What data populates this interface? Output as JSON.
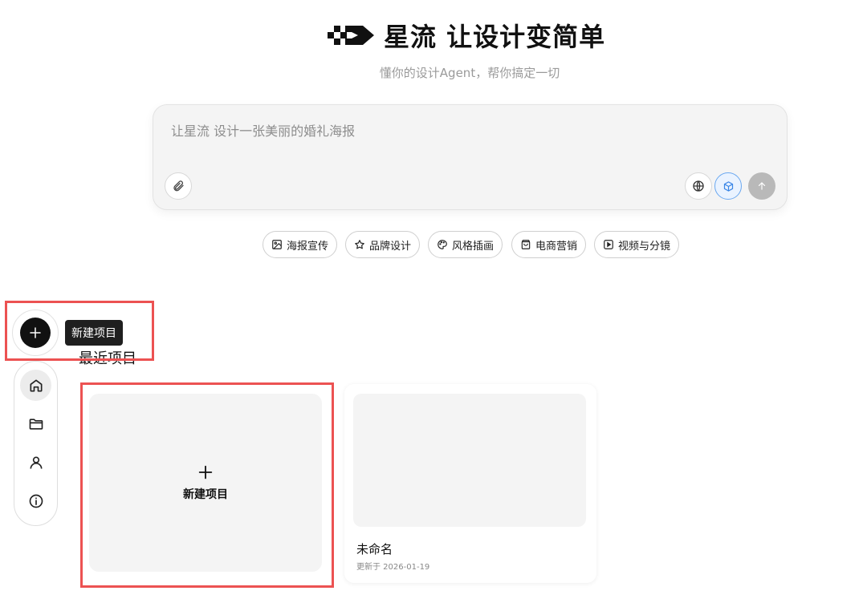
{
  "header": {
    "title": "星流 让设计变简单",
    "subtitle": "懂你的设计Agent，帮你搞定一切"
  },
  "prompt": {
    "placeholder": "让星流 设计一张美丽的婚礼海报",
    "icons": [
      "paperclip-icon",
      "globe-icon",
      "cube-icon",
      "arrow-up-icon"
    ],
    "model_accent": "#6aa8f0"
  },
  "chips": [
    {
      "label": "海报宣传",
      "icon": "image-icon"
    },
    {
      "label": "品牌设计",
      "icon": "star-icon"
    },
    {
      "label": "风格插画",
      "icon": "palette-icon"
    },
    {
      "label": "电商营销",
      "icon": "shopping-bag-icon"
    },
    {
      "label": "视频与分镜",
      "icon": "play-icon"
    }
  ],
  "fab": {
    "tooltip": "新建项目"
  },
  "sidebar": {
    "items": [
      {
        "icon": "home-icon",
        "active": true
      },
      {
        "icon": "folder-icon",
        "active": false
      },
      {
        "icon": "user-icon",
        "active": false
      },
      {
        "icon": "info-icon",
        "active": false
      }
    ]
  },
  "recent": {
    "title": "最近项目",
    "new_card_label": "新建项目",
    "projects": [
      {
        "name": "未命名",
        "updated": "更新于 2026-01-19"
      }
    ]
  },
  "colors": {
    "highlight_box": "#ec5252",
    "tooltip_bg": "#1f1f1f",
    "card_bg": "#f4f4f4"
  }
}
